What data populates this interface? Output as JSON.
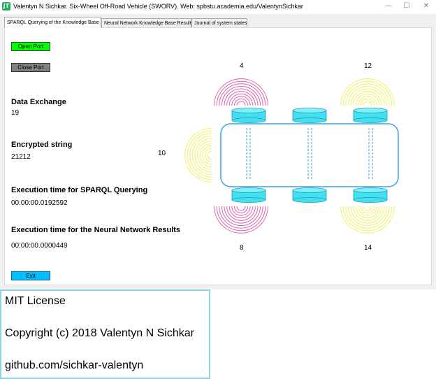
{
  "window": {
    "title": "Valentyn N Sichkar. Six-Wheel Off-Road Vehicle (SWORV). Web: spbstu.academia.edu/ValentynSichkar",
    "icon": "app-logo-icon",
    "controls": {
      "minimize": "—",
      "maximize": "☐",
      "close": "✕"
    }
  },
  "tabs": [
    {
      "label": "SPARQL Querying of the Knowledge Base",
      "active": true
    },
    {
      "label": "Neural Network Knowledge Base Results",
      "active": false
    },
    {
      "label": "Journal of system states",
      "active": false
    }
  ],
  "buttons": {
    "open_port": "Open Port",
    "close_port": "Close Port",
    "exit": "Exit"
  },
  "colors": {
    "open_port": "#00ff00",
    "close_port": "#808080",
    "exit": "#00bfff",
    "wheel": "#40e0f0",
    "body_outline": "#3aa0e0",
    "sensor_pink": "#e060b0",
    "sensor_yellow": "#f0f060"
  },
  "fields": {
    "data_exchange_label": "Data Exchange",
    "data_exchange_value": "19",
    "encrypted_label": "Encrypted string",
    "encrypted_value": "21212",
    "sparql_time_label": "Execution time for SPARQL Querying",
    "sparql_time_value": "00:00:00.0192592",
    "nn_time_label": "Execution time for the Neural Network Results",
    "nn_time_value": "00:00:00.0000449"
  },
  "sensors": {
    "front_left": "4",
    "front_right": "12",
    "left": "10",
    "rear_left": "8",
    "rear_right": "14"
  },
  "license": {
    "line1": "MIT License",
    "line2": "Copyright (c) 2018  Valentyn N Sichkar",
    "line3": "github.com/sichkar-valentyn"
  }
}
